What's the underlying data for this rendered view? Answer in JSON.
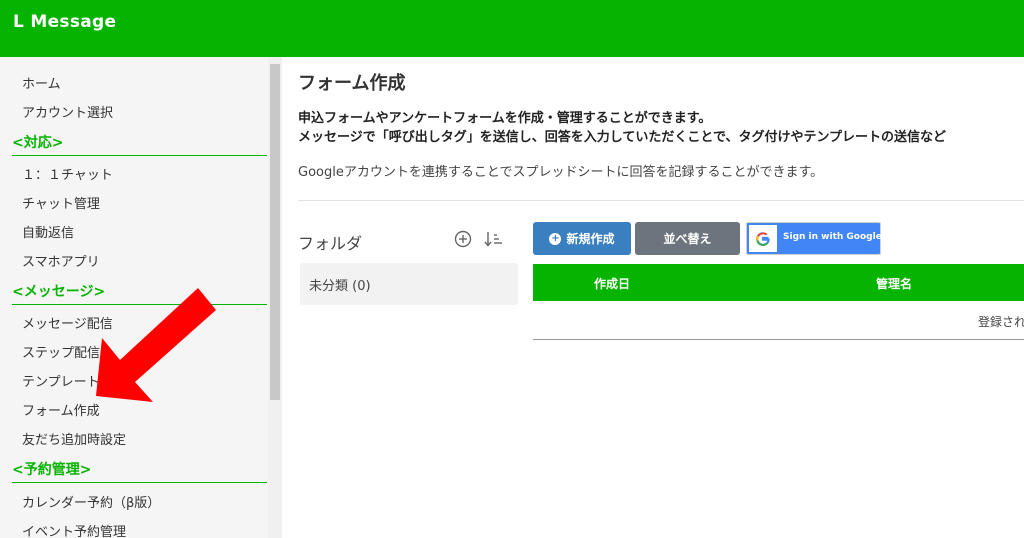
{
  "app": {
    "title": "L Message"
  },
  "sidebar": {
    "items": [
      {
        "type": "item",
        "label": "ホーム"
      },
      {
        "type": "item",
        "label": "アカウント選択"
      },
      {
        "type": "section",
        "label": "<対応>"
      },
      {
        "type": "item",
        "label": "１：１チャット"
      },
      {
        "type": "item",
        "label": "チャット管理"
      },
      {
        "type": "item",
        "label": "自動返信"
      },
      {
        "type": "item",
        "label": "スマホアプリ"
      },
      {
        "type": "section",
        "label": "<メッセージ>"
      },
      {
        "type": "item",
        "label": "メッセージ配信"
      },
      {
        "type": "item",
        "label": "ステップ配信"
      },
      {
        "type": "item",
        "label": "テンプレート"
      },
      {
        "type": "item",
        "label": "フォーム作成"
      },
      {
        "type": "item",
        "label": "友だち追加時設定"
      },
      {
        "type": "section",
        "label": "<予約管理>"
      },
      {
        "type": "item",
        "label": "カレンダー予約（β版）"
      },
      {
        "type": "item",
        "label": "イベント予約管理"
      }
    ]
  },
  "main": {
    "title": "フォーム作成",
    "description_line1": "申込フォームやアンケートフォームを作成・管理することができます。",
    "description_line2": "メッセージで「呼び出しタグ」を送信し、回答を入力していただくことで、タグ付けやテンプレートの送信など",
    "description_google": "Googleアカウントを連携することでスプレッドシートに回答を記録することができます。",
    "folder_title": "フォルダ",
    "folders": [
      {
        "label": "未分類 (0)"
      }
    ],
    "buttons": {
      "new": "新規作成",
      "sort": "並べ替え",
      "google": "Sign in with Google"
    },
    "table": {
      "columns": [
        "作成日",
        "管理名"
      ],
      "empty_text": "登録され"
    }
  },
  "icons": {
    "folder_add": "plus-circle-icon",
    "folder_sort": "sort-icon",
    "annotation": "red-arrow-icon"
  },
  "colors": {
    "brand_green": "#06b400",
    "primary_blue": "#3a7fc0",
    "secondary_gray": "#6c757d",
    "google_blue": "#4285f4",
    "annotation_red": "#ff0000"
  }
}
